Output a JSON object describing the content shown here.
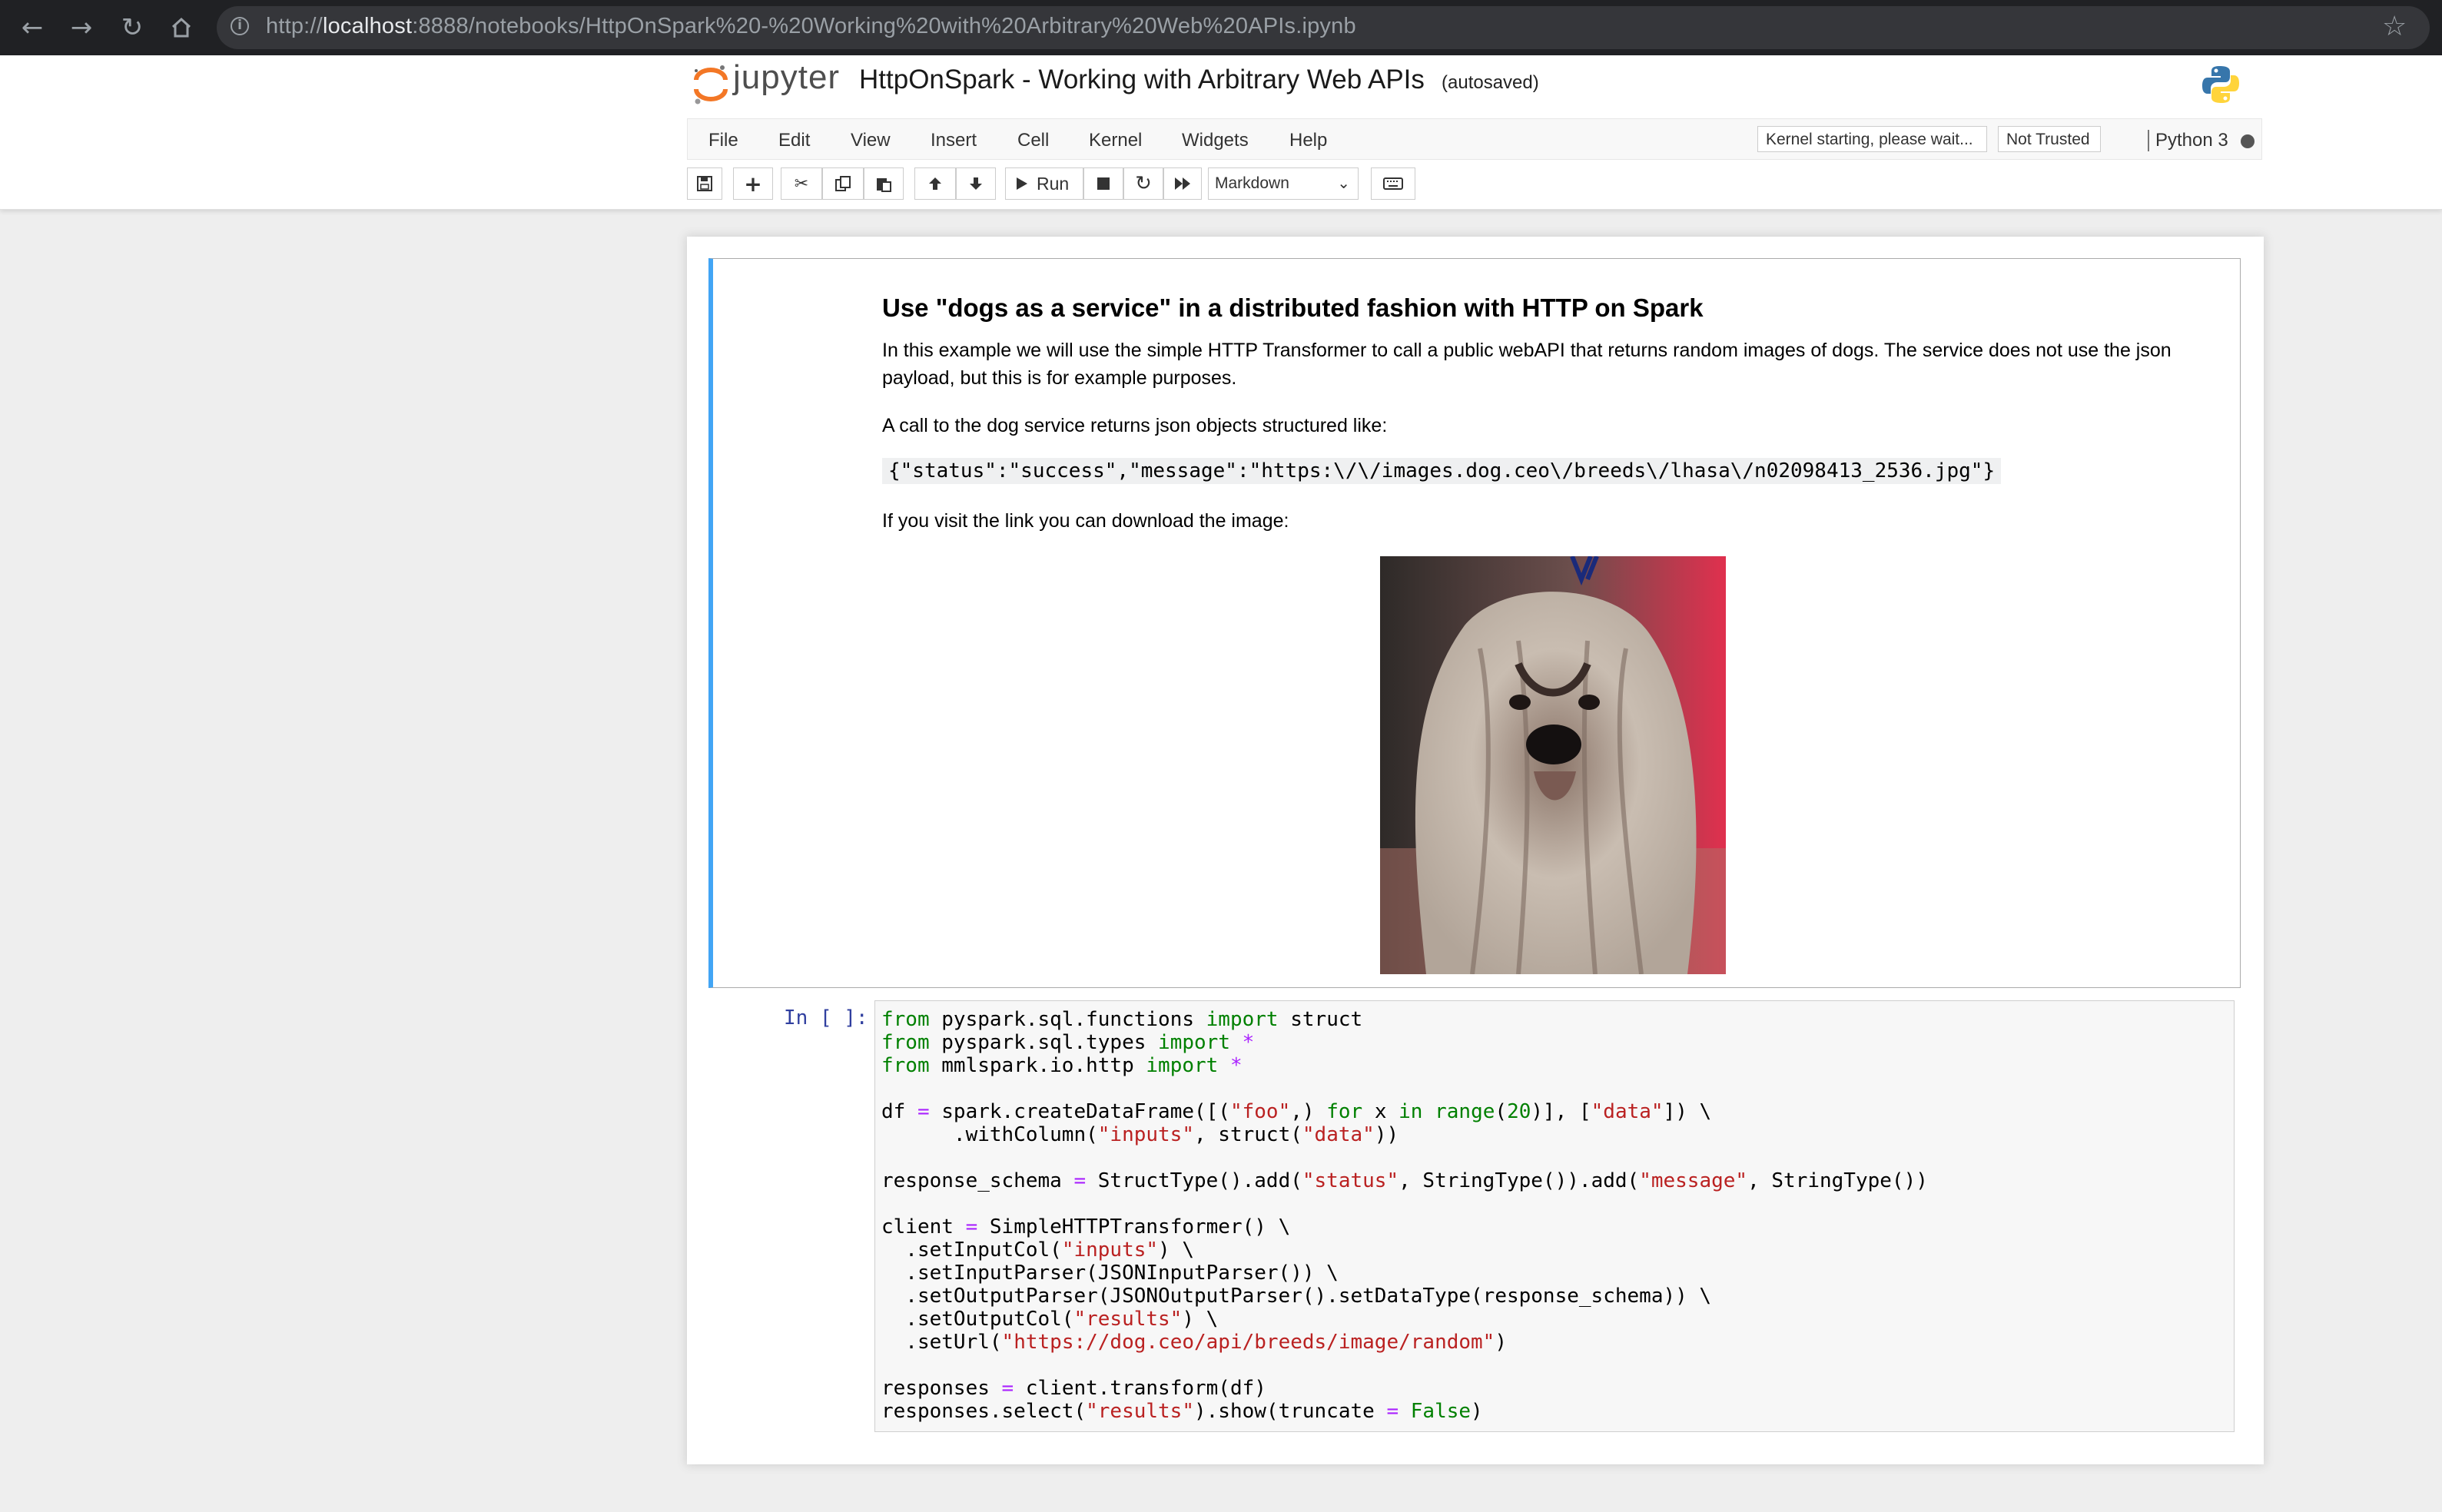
{
  "browser": {
    "url_prefix": "http://",
    "url_host": "localhost",
    "url_rest": ":8888/notebooks/HttpOnSpark%20-%20Working%20with%20Arbitrary%20Web%20APIs.ipynb"
  },
  "header": {
    "logo_text": "jupyter",
    "notebook_title": "HttpOnSpark - Working with Arbitrary Web APIs",
    "autosave_status": "(autosaved)"
  },
  "menubar": {
    "items": [
      "File",
      "Edit",
      "View",
      "Insert",
      "Cell",
      "Kernel",
      "Widgets",
      "Help"
    ],
    "kernel_status": "Kernel starting, please wait...",
    "trust_status": "Not Trusted",
    "kernel_name": "Python 3"
  },
  "toolbar": {
    "run_label": "Run",
    "cell_type": "Markdown"
  },
  "markdown_cell": {
    "heading": "Use \"dogs as a service\" in a distributed fashion with HTTP on Spark",
    "paragraph1": "In this example we will use the simple HTTP Transformer to call a public webAPI that returns random images of dogs. The service does not use the json payload, but this is for example purposes.",
    "paragraph2": "A call to the dog service returns json objects structured like:",
    "json_example": "{\"status\":\"success\",\"message\":\"https:\\/\\/images.dog.ceo\\/breeds\\/lhasa\\/n02098413_2536.jpg\"}",
    "paragraph3": "If you visit the link you can download the image:"
  },
  "code_cell": {
    "prompt": "In [ ]:",
    "lines": [
      [
        [
          "kw",
          "from"
        ],
        [
          "t",
          " pyspark.sql.functions "
        ],
        [
          "kw",
          "import"
        ],
        [
          "t",
          " struct"
        ]
      ],
      [
        [
          "kw",
          "from"
        ],
        [
          "t",
          " pyspark.sql.types "
        ],
        [
          "kw",
          "import"
        ],
        [
          "t",
          " "
        ],
        [
          "op",
          "*"
        ]
      ],
      [
        [
          "kw",
          "from"
        ],
        [
          "t",
          " mmlspark.io.http "
        ],
        [
          "kw",
          "import"
        ],
        [
          "t",
          " "
        ],
        [
          "op",
          "*"
        ]
      ],
      [],
      [
        [
          "t",
          "df "
        ],
        [
          "op",
          "="
        ],
        [
          "t",
          " spark.createDataFrame([("
        ],
        [
          "str",
          "\"foo\""
        ],
        [
          "t",
          ",) "
        ],
        [
          "kw",
          "for"
        ],
        [
          "t",
          " x "
        ],
        [
          "kw",
          "in"
        ],
        [
          "t",
          " "
        ],
        [
          "kw",
          "range"
        ],
        [
          "t",
          "("
        ],
        [
          "num",
          "20"
        ],
        [
          "t",
          ")], ["
        ],
        [
          "str",
          "\"data\""
        ],
        [
          "t",
          "]) \\"
        ]
      ],
      [
        [
          "t",
          "      .withColumn("
        ],
        [
          "str",
          "\"inputs\""
        ],
        [
          "t",
          ", struct("
        ],
        [
          "str",
          "\"data\""
        ],
        [
          "t",
          "))"
        ]
      ],
      [],
      [
        [
          "t",
          "response_schema "
        ],
        [
          "op",
          "="
        ],
        [
          "t",
          " StructType().add("
        ],
        [
          "str",
          "\"status\""
        ],
        [
          "t",
          ", StringType()).add("
        ],
        [
          "str",
          "\"message\""
        ],
        [
          "t",
          ", StringType())"
        ]
      ],
      [],
      [
        [
          "t",
          "client "
        ],
        [
          "op",
          "="
        ],
        [
          "t",
          " SimpleHTTPTransformer() \\"
        ]
      ],
      [
        [
          "t",
          "  .setInputCol("
        ],
        [
          "str",
          "\"inputs\""
        ],
        [
          "t",
          ") \\"
        ]
      ],
      [
        [
          "t",
          "  .setInputParser(JSONInputParser()) \\"
        ]
      ],
      [
        [
          "t",
          "  .setOutputParser(JSONOutputParser().setDataType(response_schema)) \\"
        ]
      ],
      [
        [
          "t",
          "  .setOutputCol("
        ],
        [
          "str",
          "\"results\""
        ],
        [
          "t",
          ") \\"
        ]
      ],
      [
        [
          "t",
          "  .setUrl("
        ],
        [
          "str",
          "\"https://dog.ceo/api/breeds/image/random\""
        ],
        [
          "t",
          ")"
        ]
      ],
      [],
      [
        [
          "t",
          "responses "
        ],
        [
          "op",
          "="
        ],
        [
          "t",
          " client.transform(df)"
        ]
      ],
      [
        [
          "t",
          "responses.select("
        ],
        [
          "str",
          "\"results\""
        ],
        [
          "t",
          ").show(truncate "
        ],
        [
          "op",
          "="
        ],
        [
          "t",
          " "
        ],
        [
          "kw",
          "False"
        ],
        [
          "t",
          ")"
        ]
      ]
    ]
  },
  "icons": [
    "back-arrow-icon",
    "forward-arrow-icon",
    "reload-icon",
    "home-icon",
    "info-icon",
    "star-icon",
    "save-icon",
    "plus-icon",
    "cut-icon",
    "copy-icon",
    "paste-icon",
    "arrow-up-icon",
    "arrow-down-icon",
    "play-icon",
    "stop-icon",
    "restart-icon",
    "fast-forward-icon",
    "keyboard-icon",
    "kernel-idle-dot-icon"
  ]
}
